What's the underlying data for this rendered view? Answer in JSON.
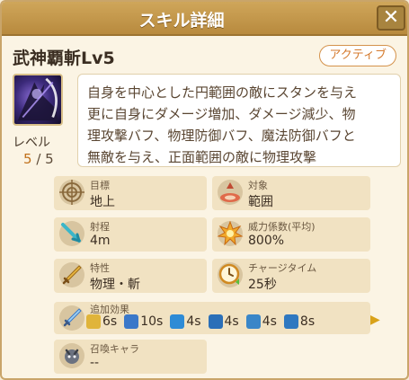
{
  "window": {
    "title": "スキル詳細",
    "close_label": "✕"
  },
  "skill": {
    "name": "武神覇斬Lv5",
    "type_badge": "アクティブ",
    "level_label": "レベル",
    "level_current": "5",
    "level_max": "/ 5",
    "description_lines": [
      "自身を中心とした円範囲の敵にスタンを与え",
      "更に自身にダメージ増加、ダメージ減少、物",
      "理攻撃バフ、物理防御バフ、魔法防御バフと",
      "無敵を与え、正面範囲の敵に物理攻撃"
    ]
  },
  "stats": {
    "target": {
      "label": "目標",
      "value": "地上",
      "icon": "target-icon"
    },
    "object": {
      "label": "対象",
      "value": "範囲",
      "icon": "area-icon"
    },
    "range": {
      "label": "射程",
      "value": "4m",
      "icon": "range-icon"
    },
    "power": {
      "label": "威力係数(平均)",
      "value": "800%",
      "icon": "explosion-icon"
    },
    "trait": {
      "label": "特性",
      "value": "物理・斬",
      "icon": "sword-icon"
    },
    "charge": {
      "label": "チャージタイム",
      "value": "25秒",
      "icon": "clock-icon"
    }
  },
  "effects": {
    "label": "追加効果",
    "items": [
      {
        "value": "6s",
        "icon": "stun-icon",
        "color": "#e0b43a"
      },
      {
        "value": "10s",
        "icon": "damage-up-icon",
        "color": "#3b78c9"
      },
      {
        "value": "4s",
        "icon": "damage-down-icon",
        "color": "#2e8bd6"
      },
      {
        "value": "4s",
        "icon": "phys-atk-up-icon",
        "color": "#2b6fb8"
      },
      {
        "value": "4s",
        "icon": "phys-def-up-icon",
        "color": "#3a86c8"
      },
      {
        "value": "8s",
        "icon": "invincible-icon",
        "color": "#2f78c0"
      }
    ]
  },
  "summon": {
    "label": "召喚キャラ",
    "value": "--",
    "icon": "summon-icon"
  }
}
